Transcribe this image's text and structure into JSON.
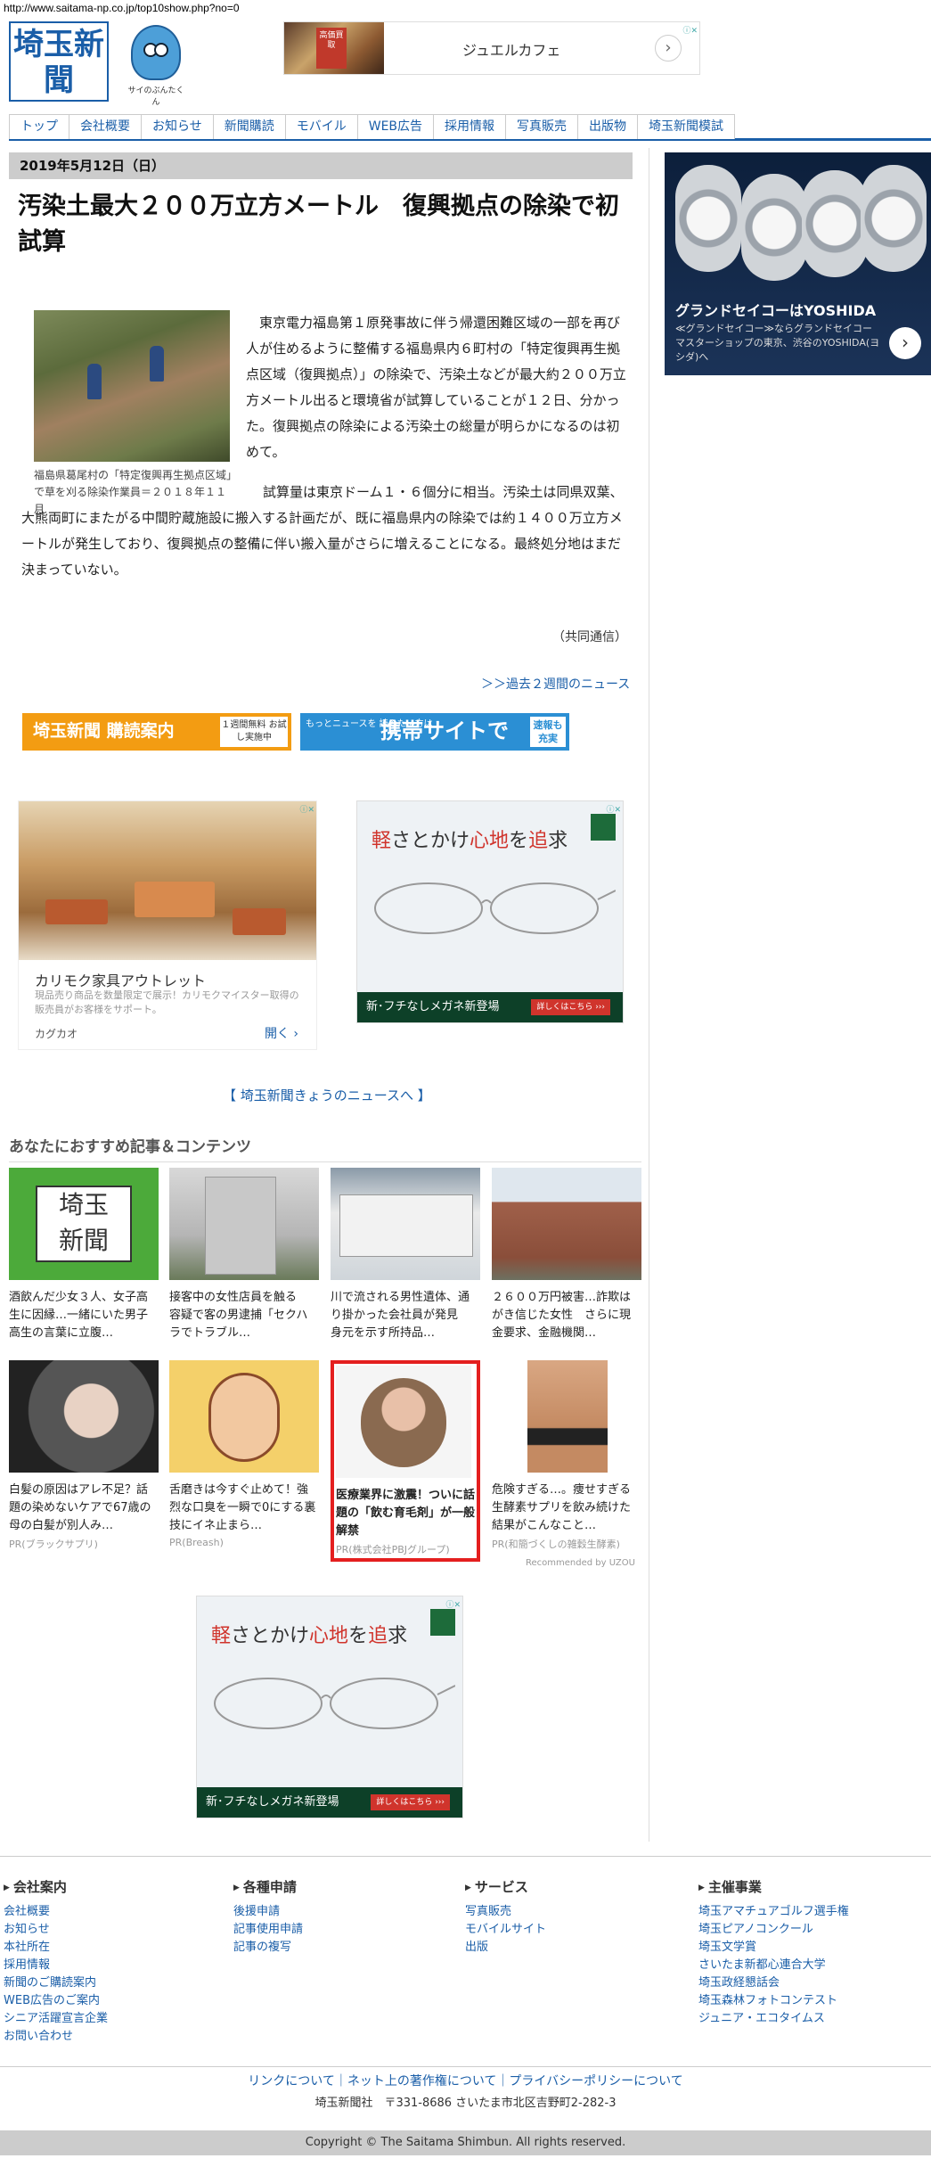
{
  "url": "http://www.saitama-np.co.jp/top10show.php?no=0",
  "brand": {
    "logo_text": "埼玉新聞",
    "mascot_caption": "サイのぶんたくん"
  },
  "top_ad": {
    "thumb_label": "高価買取",
    "text": "ジュエルカフェ",
    "arrow": "›",
    "adchoices": "ⓘ✕"
  },
  "nav": [
    "トップ",
    "会社概要",
    "お知らせ",
    "新聞購読",
    "モバイル",
    "WEB広告",
    "採用情報",
    "写真販売",
    "出版物",
    "埼玉新聞模試"
  ],
  "article": {
    "date": "2019年5月12日（日）",
    "headline": "汚染土最大２００万立方メートル　復興拠点の除染で初試算",
    "caption": "福島県葛尾村の「特定復興再生拠点区域」で草を刈る除染作業員＝２０１８年１１月",
    "para1": "　東京電力福島第１原発事故に伴う帰還困難区域の一部を再び人が住めるように整備する福島県内６町村の「特定復興再生拠点区域（復興拠点）」の除染で、汚染土などが最大約２００万立方メートル出ると環境省が試算していることが１２日、分かった。復興拠点の除染による汚染土の総量が明らかになるのは初めて。",
    "para2": "　試算量は東京ドーム１・６個分に相当。汚染土は同県双葉、大熊両町にまたがる中間貯蔵施設に搬入する計画だが、既に福島県内の除染では約１４００万立方メートルが発生しており、復興拠点の整備に伴い搬入量がさらに増えることになる。最終処分地はまだ決まっていない。",
    "credit": "（共同通信）",
    "past_link": "＞＞過去２週間のニュース"
  },
  "promo": {
    "subscribe_label": "埼玉新聞 購読案内",
    "subscribe_box": "１週間無料 お試し実施中",
    "mobile_small": "もっとニュースを 読みたい方は",
    "mobile_label": "携帯サイトで",
    "mobile_box": "速報も 充実"
  },
  "ad_furniture": {
    "title": "カリモク家具アウトレット",
    "desc": "現品売り商品を数量限定で展示！カリモクマイスター取得の販売員がお客様をサポート。",
    "advertiser": "カグカオ",
    "cta": "開く ›"
  },
  "ad_glasses": {
    "head_plain_1": "軽",
    "head_plain_2": "さとかけ",
    "head_red": "心地",
    "head_plain_3": "を",
    "head_red_2": "追",
    "head_plain_4": "求",
    "footer": "新･フチなしメガネ新登場",
    "button": "詳しくはこちら ›››"
  },
  "today_news_link": "【 埼玉新聞きょうのニュースへ 】",
  "recommend": {
    "title": "あなたにおすすめ記事＆コンテンツ",
    "items": [
      {
        "text": "酒飲んだ少女３人、女子高生に因縁…一緒にいた男子高生の言葉に立腹…",
        "pr": ""
      },
      {
        "text": "接客中の女性店員を触る　容疑で客の男逮捕「セクハラでトラブル…",
        "pr": ""
      },
      {
        "text": "川で流される男性遺体、通り掛かった会社員が発見　身元を示す所持品…",
        "pr": ""
      },
      {
        "text": "２６００万円被害…詐欺はがき信じた女性　さらに現金要求、金融機関…",
        "pr": ""
      },
      {
        "text": "白髪の原因はアレ不足？話題の染めないケアで67歳の母の白髪が別人み…",
        "pr": "PR(ブラックサプリ)"
      },
      {
        "text": "舌磨きは今すぐ止めて！強烈な口臭を一瞬で0にする裏技にイネ止まら…",
        "pr": "PR(Breash)"
      },
      {
        "text": "医療業界に激震！ついに話題の「飲む育毛剤」が一般解禁",
        "pr": "PR(株式会社PBJグループ)"
      },
      {
        "text": "危険すぎる…。痩せすぎる生酵素サプリを飲み続けた結果がこんなこと…",
        "pr": "PR(和簡づくしの雑穀生酵素)"
      }
    ],
    "credit": "Recommended by UZOU"
  },
  "right_ad": {
    "title": "グランドセイコーはYOSHIDA",
    "desc": "≪グランドセイコー≫ならグランドセイコーマスターショップの東京、渋谷のYOSHIDA(ヨシダ)へ",
    "arrow": "›"
  },
  "footer": {
    "columns": [
      {
        "heading": "会社案内",
        "items": [
          "会社概要",
          "お知らせ",
          "本社所在",
          "採用情報",
          "新聞のご購読案内",
          "WEB広告のご案内",
          "シニア活躍宣言企業",
          "お問い合わせ"
        ]
      },
      {
        "heading": "各種申請",
        "items": [
          "後援申請",
          "記事使用申請",
          "記事の複写"
        ]
      },
      {
        "heading": "サービス",
        "items": [
          "写真販売",
          "モバイルサイト",
          "出版"
        ]
      },
      {
        "heading": "主催事業",
        "items": [
          "埼玉アマチュアゴルフ選手権",
          "埼玉ピアノコンクール",
          "埼玉文学賞",
          "さいたま新都心連合大学",
          "埼玉政経懇話会",
          "埼玉森林フォトコンテスト",
          "ジュニア・エコタイムス"
        ]
      }
    ],
    "links": "リンクについて｜ネット上の著作権について｜プライバシーポリシーについて",
    "address": "埼玉新聞社　〒331-8686 さいたま市北区吉野町2-282-3",
    "copyright": "Copyright © The Saitama Shimbun. All rights reserved."
  }
}
